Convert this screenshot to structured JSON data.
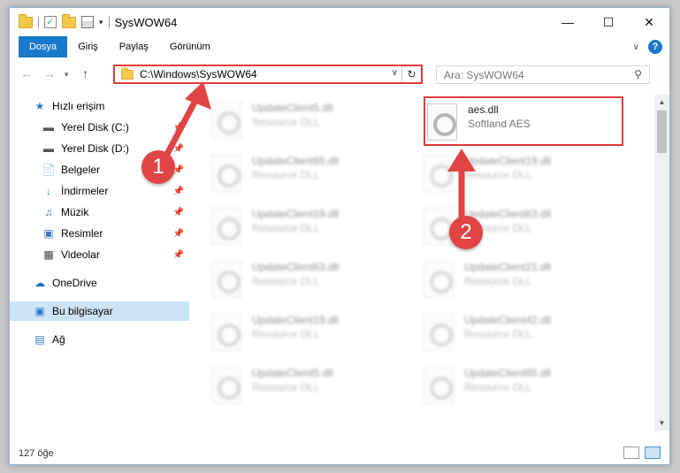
{
  "window": {
    "title": "SysWOW64"
  },
  "ribbon": {
    "tabs": [
      "Dosya",
      "Giriş",
      "Paylaş",
      "Görünüm"
    ]
  },
  "address": {
    "path": "C:\\Windows\\SysWOW64"
  },
  "search": {
    "placeholder": "Ara: SysWOW64"
  },
  "sidebar": {
    "items": [
      {
        "label": "Hızlı erişim",
        "icon": "star-icon"
      },
      {
        "label": "Yerel Disk (C:)",
        "icon": "drive-icon"
      },
      {
        "label": "Yerel Disk (D:)",
        "icon": "drive-icon"
      },
      {
        "label": "Belgeler",
        "icon": "document-icon"
      },
      {
        "label": "İndirmeler",
        "icon": "download-icon"
      },
      {
        "label": "Müzik",
        "icon": "music-icon"
      },
      {
        "label": "Resimler",
        "icon": "pictures-icon"
      },
      {
        "label": "Videolar",
        "icon": "video-icon"
      },
      {
        "label": "OneDrive",
        "icon": "cloud-icon"
      },
      {
        "label": "Bu bilgisayar",
        "icon": "computer-icon"
      },
      {
        "label": "Ağ",
        "icon": "network-icon"
      }
    ]
  },
  "files": [
    {
      "name": "UpdateClient5.dll",
      "type": "Resource DLL"
    },
    {
      "name": "aes.dll",
      "type": "Softland AES"
    },
    {
      "name": "UpdateClient65.dll",
      "type": "Resource DLL"
    },
    {
      "name": "UpdateClient19.dll",
      "type": "Resource DLL"
    },
    {
      "name": "UpdateClient19.dll",
      "type": "Resource DLL"
    },
    {
      "name": "UpdateClient63.dll",
      "type": "Resource DLL"
    },
    {
      "name": "UpdateClient63.dll",
      "type": "Resource DLL"
    },
    {
      "name": "UpdateClient21.dll",
      "type": "Resource DLL"
    },
    {
      "name": "UpdateClient19.dll",
      "type": "Resource DLL"
    },
    {
      "name": "UpdateClient42.dll",
      "type": "Resource DLL"
    },
    {
      "name": "UpdateClient5.dll",
      "type": "Resource DLL"
    },
    {
      "name": "UpdateClient65.dll",
      "type": "Resource DLL"
    }
  ],
  "status": {
    "count": "127 öğe"
  },
  "annotations": {
    "badge1": "1",
    "badge2": "2",
    "color": "#e04444"
  }
}
